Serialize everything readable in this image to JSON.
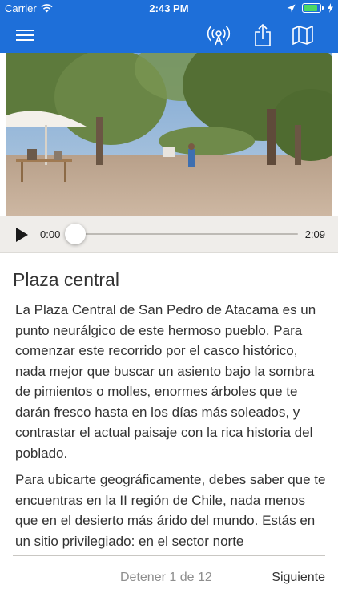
{
  "status_bar": {
    "carrier": "Carrier",
    "time": "2:43 PM",
    "battery_level": 0.92,
    "battery_color": "#4cd964"
  },
  "nav": {
    "background": "#1e6fd9",
    "icons": [
      "menu-icon",
      "broadcast-icon",
      "share-icon",
      "map-icon"
    ]
  },
  "hero": {
    "icon": "plaza-photo"
  },
  "player": {
    "current_time": "0:00",
    "total_time": "2:09",
    "progress": 0.0
  },
  "content": {
    "title": "Plaza central",
    "paragraphs": [
      "La Plaza Central de San Pedro de Atacama es un punto neurálgico de este hermoso pueblo. Para comenzar este recorrido por el casco histórico, nada mejor que buscar un asiento bajo la sombra de pimientos o molles, enormes árboles que te darán fresco hasta en los días más soleados, y contrastar el actual paisaje con la rica historia del poblado.",
      "Para ubicarte geográficamente, debes saber que te encuentras en la II región de Chile, nada menos que en el desierto más árido del mundo. Estás en un sitio privilegiado: en el sector norte"
    ]
  },
  "footer": {
    "stop_label": "Detener 1 de 12",
    "next_label": "Siguiente"
  }
}
